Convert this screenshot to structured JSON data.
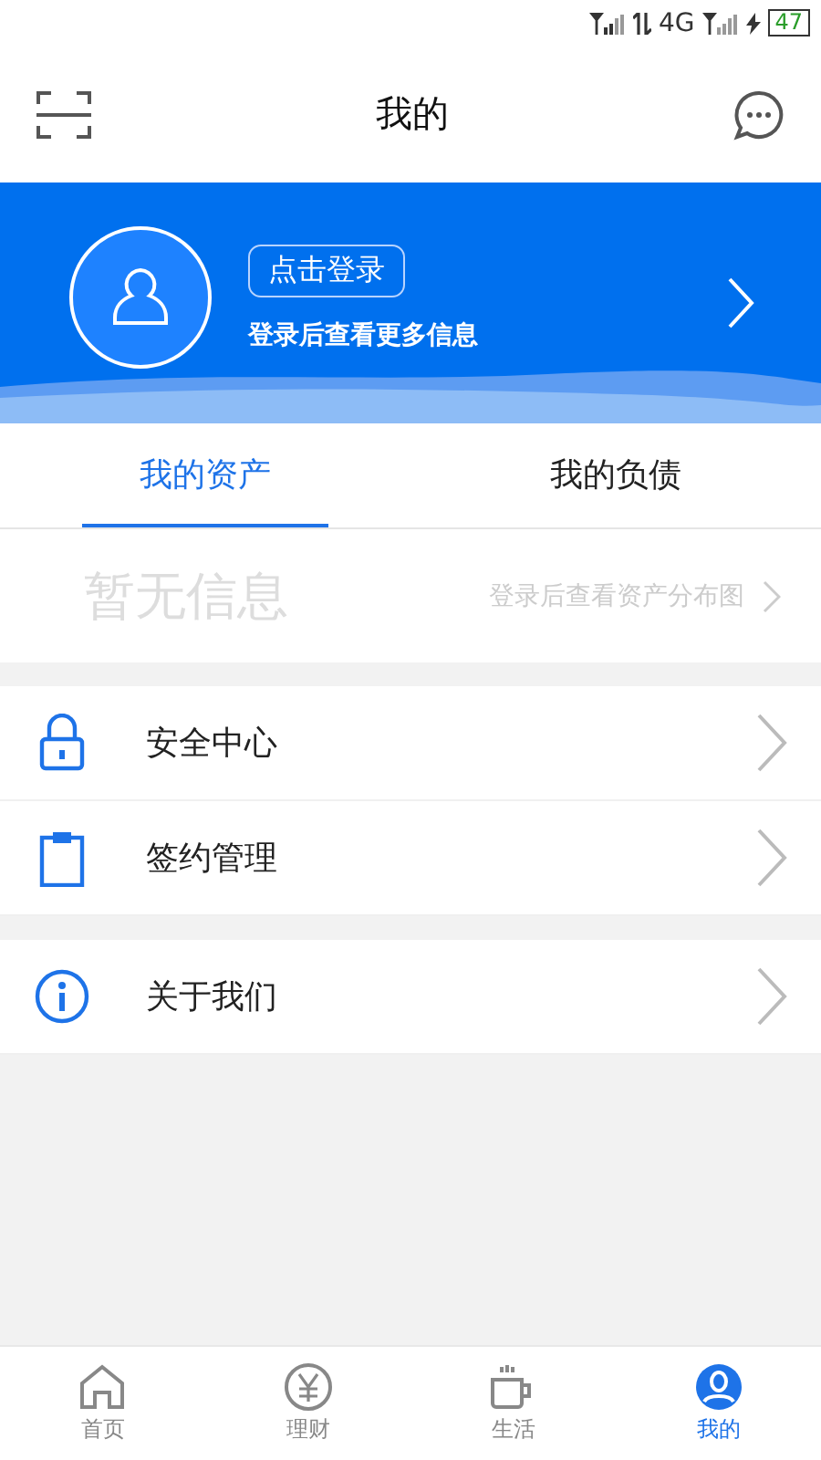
{
  "status_bar": {
    "network": "4G",
    "battery": "47"
  },
  "header": {
    "title": "我的"
  },
  "profile": {
    "login_button": "点击登录",
    "hint": "登录后查看更多信息"
  },
  "tabs": [
    {
      "label": "我的资产",
      "selected": true
    },
    {
      "label": "我的负债",
      "selected": false
    }
  ],
  "assets": {
    "empty_text": "暂无信息",
    "link": "登录后查看资产分布图"
  },
  "menu_groups": [
    [
      {
        "kind": "lock",
        "label": "安全中心"
      },
      {
        "kind": "clipboard",
        "label": "签约管理"
      }
    ],
    [
      {
        "kind": "info",
        "label": "关于我们"
      }
    ]
  ],
  "nav": [
    {
      "kind": "home",
      "label": "首页",
      "selected": false
    },
    {
      "kind": "yen",
      "label": "理财",
      "selected": false
    },
    {
      "kind": "cup",
      "label": "生活",
      "selected": false
    },
    {
      "kind": "user",
      "label": "我的",
      "selected": true
    }
  ]
}
